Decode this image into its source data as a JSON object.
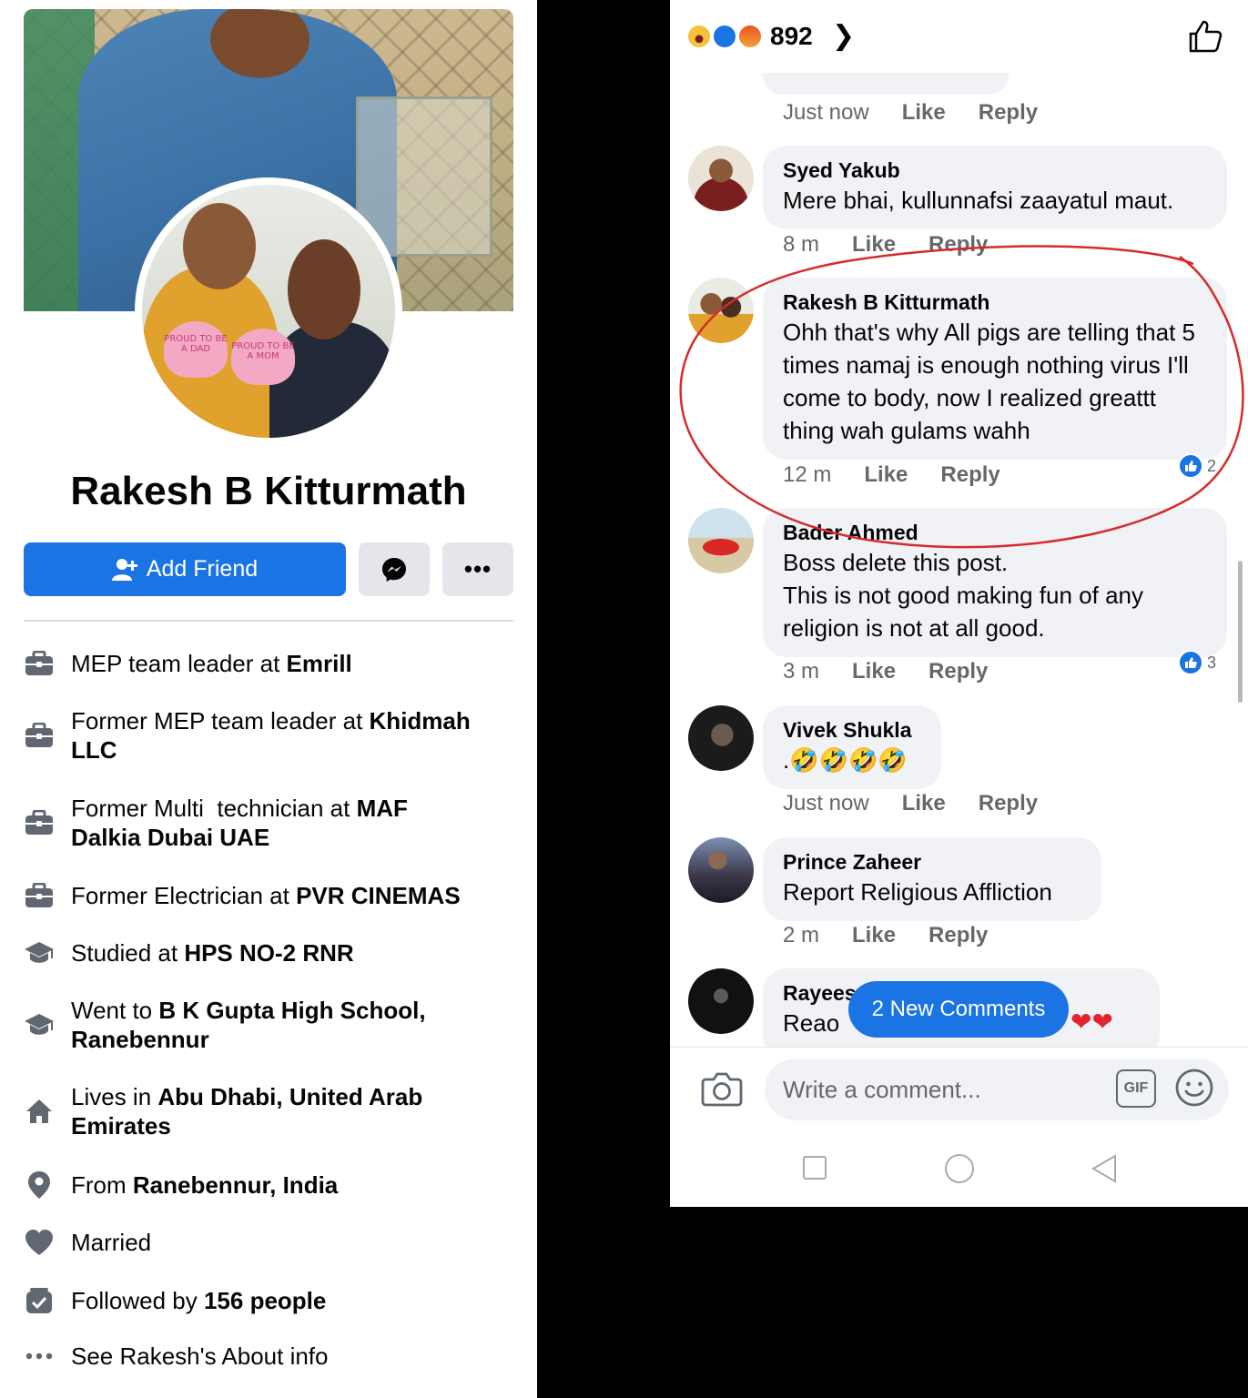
{
  "profile": {
    "name": "Rakesh B Kitturmath",
    "add_friend_label": "Add Friend",
    "more_label": "•••",
    "avatar_sign_left": "PROUD TO BE A DAD",
    "avatar_sign_right": "PROUD TO BE A MOM",
    "info": [
      {
        "icon": "briefcase-icon",
        "prefix": "MEP team leader at ",
        "bold": "Emrill"
      },
      {
        "icon": "briefcase-icon",
        "prefix": "Former MEP team leader at ",
        "bold": "Khidmah LLC"
      },
      {
        "icon": "briefcase-icon",
        "prefix": "Former Multi  technician at ",
        "bold": "MAF Dalkia Dubai UAE"
      },
      {
        "icon": "briefcase-icon",
        "prefix": "Former Electrician at ",
        "bold": "PVR CINEMAS"
      },
      {
        "icon": "graduation-cap-icon",
        "prefix": "Studied at ",
        "bold": "HPS NO-2 RNR"
      },
      {
        "icon": "graduation-cap-icon",
        "prefix": "Went to ",
        "bold": "B K Gupta High School, Ranebennur"
      },
      {
        "icon": "home-icon",
        "prefix": "Lives in ",
        "bold": "Abu Dhabi, United Arab Emirates"
      },
      {
        "icon": "location-pin-icon",
        "prefix": "From ",
        "bold": "Ranebennur, India"
      },
      {
        "icon": "heart-icon",
        "prefix": "Married",
        "bold": ""
      },
      {
        "icon": "followers-icon",
        "prefix": "Followed by ",
        "bold": "156 people"
      },
      {
        "icon": "more-dots-icon",
        "prefix": "See Rakesh's About info",
        "bold": ""
      }
    ]
  },
  "comments_panel": {
    "reaction_count": "892",
    "reactions": [
      "haha",
      "like",
      "angry"
    ],
    "partial_top_comment": {
      "time": "Just now",
      "like": "Like",
      "reply": "Reply"
    },
    "comments": [
      {
        "author": "Syed Yakub",
        "body": "Mere bhai, kullunnafsi zaayatul maut.",
        "time": "8 m",
        "like": "Like",
        "reply": "Reply",
        "likes": ""
      },
      {
        "author": "Rakesh B Kitturmath",
        "body": "Ohh that's why All pigs are telling that 5 times namaj is enough nothing virus I'll come to body, now I realized greattt thing wah gulams wahh",
        "time": "12 m",
        "like": "Like",
        "reply": "Reply",
        "likes": "2"
      },
      {
        "author": "Bader Ahmed",
        "body": "Boss delete this post.\nThis is not good making fun of any religion is not at all good.",
        "time": "3 m",
        "like": "Like",
        "reply": "Reply",
        "likes": "3"
      },
      {
        "author": "Vivek Shukla",
        "body": ".🤣🤣🤣🤣",
        "time": "Just now",
        "like": "Like",
        "reply": "Reply",
        "likes": ""
      },
      {
        "author": "Prince Zaheer",
        "body": "Report Religious Affliction",
        "time": "2 m",
        "like": "Like",
        "reply": "Reply",
        "likes": ""
      },
      {
        "author": "Rayees",
        "body": "Reao",
        "time": "",
        "like": "",
        "reply": "",
        "likes": ""
      }
    ],
    "new_comments_label": "2 New Comments",
    "composer_placeholder": "Write a comment...",
    "gif_label": "GIF"
  },
  "colors": {
    "accent": "#1b74e4",
    "annotation_red": "#d62b2b",
    "bubble": "#f0f2f5",
    "meta_text": "#65676b"
  }
}
